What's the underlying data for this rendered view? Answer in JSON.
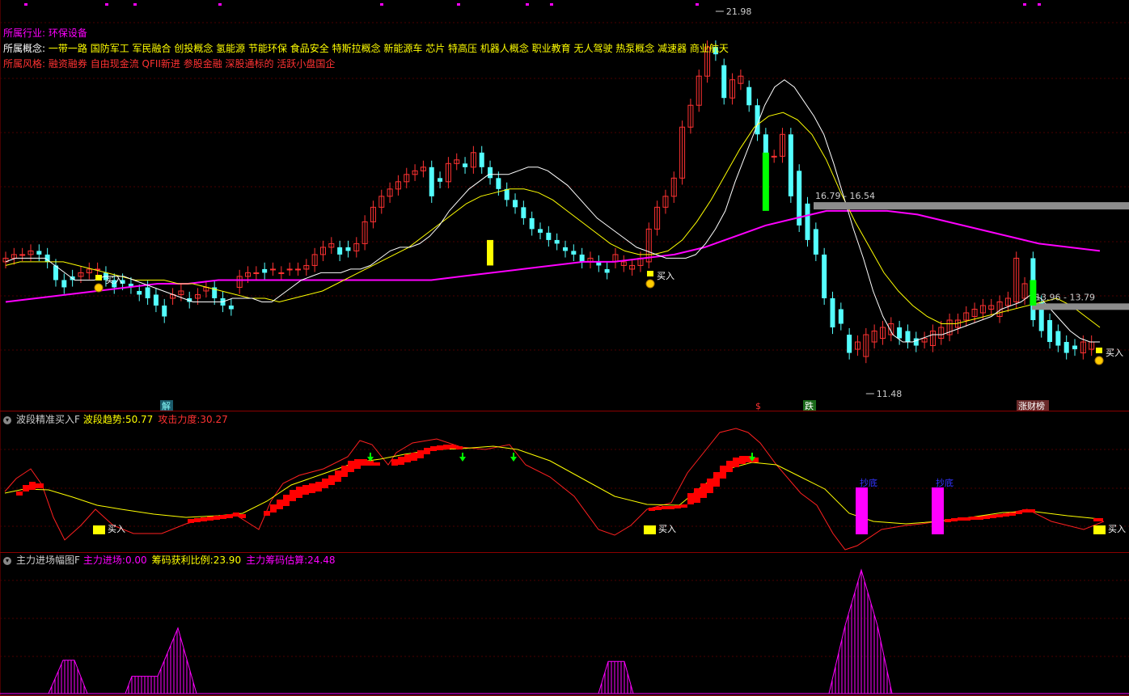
{
  "info": {
    "industry_label": "所属行业:",
    "industry_value": "环保设备",
    "concept_label": "所属概念:",
    "concept_value": "一带一路 国防军工 军民融合 创投概念 氢能源 节能环保 食品安全 特斯拉概念 新能源车 芯片 特高压 机器人概念 职业教育 无人驾驶 热泵概念 减速器 商业航天",
    "style_label": "所属风格:",
    "style_value": "融资融券 自由现金流 QFII新进 参股金融 深股通标的 活跃小盘国企"
  },
  "panel2": {
    "title": "波段精准买入F",
    "trend_label": "波段趋势:",
    "trend_value": "50.77",
    "attack_label": "攻击力度:",
    "attack_value": "30.27"
  },
  "panel3": {
    "title": "主力进场幅图F",
    "enter_label": "主力进场:",
    "enter_value": "0.00",
    "profit_label": "筹码获利比例:",
    "profit_value": "23.90",
    "est_label": "主力筹码估算:",
    "est_value": "24.48"
  },
  "markers": {
    "high_label": "21.98",
    "low_label": "11.48",
    "zone1_label": "16.79 - 16.54",
    "zone2_label": "13.96 - 13.79",
    "buy": "买入",
    "bottom": "抄底",
    "badge_jie": "解",
    "badge_dollar": "$",
    "badge_die": "跌",
    "badge_list": "涨财榜"
  },
  "colors": {
    "up": "#ff3232",
    "down": "#54ffff",
    "ma_white": "#ffffff",
    "ma_yellow": "#ffff00",
    "ma_magenta": "#ff00ff",
    "grid": "#4a0000",
    "panel_border": "#8b0000"
  },
  "chart_data": [
    {
      "type": "candlestick",
      "title": "",
      "ylim": [
        11.48,
        21.98
      ],
      "annotations": [
        "21.98",
        "11.48",
        "16.79 - 16.54",
        "13.96 - 13.79",
        "买入"
      ],
      "series_open": [
        15.1,
        15.2,
        15.3,
        15.3,
        15.4,
        15.3,
        15.0,
        14.6,
        14.7,
        14.7,
        14.8,
        14.9,
        14.8,
        14.6,
        14.6,
        14.5,
        14.3,
        14.4,
        14.2,
        13.9,
        14.1,
        14.2,
        14.1,
        14.1,
        14.3,
        14.4,
        14.1,
        13.9,
        14.4,
        14.7,
        14.8,
        14.9,
        14.9,
        14.8,
        14.9,
        14.9,
        14.9,
        15.0,
        15.3,
        15.5,
        15.5,
        15.5,
        15.4,
        15.6,
        16.2,
        16.6,
        16.9,
        17.1,
        17.3,
        17.5,
        17.6,
        17.7,
        17.4,
        17.3,
        17.8,
        17.8,
        17.7,
        18.1,
        17.7,
        17.4,
        17.1,
        16.8,
        16.6,
        16.3,
        16.0,
        15.9,
        15.7,
        15.5,
        15.4,
        15.3,
        15.1,
        15.1,
        14.9,
        15.1,
        15.0,
        14.9,
        15.0,
        15.1,
        16.0,
        16.6,
        16.9,
        17.4,
        18.8,
        19.4,
        20.2,
        21.0,
        20.5,
        19.6,
        20.0,
        19.9,
        19.4,
        18.6,
        18.0,
        18.0,
        18.6,
        17.6,
        16.7,
        16.0,
        15.3,
        14.1,
        13.8,
        13.1,
        12.7,
        12.5,
        12.9,
        13.0,
        13.1,
        13.3,
        13.2,
        13.0,
        12.9,
        12.8,
        13.0,
        13.1,
        13.3,
        13.5,
        13.6,
        13.7,
        13.8,
        13.6,
        13.9,
        14.0,
        14.1,
        15.2,
        14.0,
        13.5,
        13.2,
        12.9,
        12.8,
        12.6,
        12.7,
        12.9
      ],
      "series_close": [
        15.2,
        15.3,
        15.3,
        15.4,
        15.3,
        15.1,
        14.6,
        14.4,
        14.6,
        14.8,
        14.9,
        14.9,
        14.6,
        14.4,
        14.5,
        14.4,
        14.2,
        14.1,
        13.9,
        13.6,
        14.2,
        14.3,
        14.0,
        14.2,
        14.4,
        14.1,
        13.9,
        13.8,
        14.7,
        14.8,
        14.8,
        14.8,
        14.9,
        14.8,
        14.9,
        14.9,
        15.0,
        15.3,
        15.5,
        15.6,
        15.3,
        15.4,
        15.6,
        16.2,
        16.6,
        16.9,
        17.1,
        17.3,
        17.5,
        17.6,
        17.7,
        16.9,
        17.3,
        17.8,
        17.9,
        17.7,
        18.1,
        17.7,
        17.4,
        17.1,
        16.8,
        16.6,
        16.3,
        16.0,
        15.9,
        15.7,
        15.6,
        15.4,
        15.3,
        15.1,
        15.2,
        15.0,
        14.8,
        15.3,
        15.1,
        15.0,
        15.2,
        16.0,
        16.6,
        16.9,
        17.4,
        18.8,
        19.4,
        20.2,
        21.0,
        20.8,
        19.6,
        20.1,
        20.2,
        19.4,
        18.6,
        18.0,
        18.0,
        18.6,
        16.9,
        16.1,
        15.7,
        15.3,
        14.1,
        13.3,
        13.4,
        12.6,
        12.9,
        13.1,
        13.2,
        13.3,
        13.4,
        13.0,
        12.9,
        12.8,
        13.0,
        13.2,
        13.3,
        13.5,
        13.5,
        13.7,
        13.8,
        13.9,
        13.9,
        14.0,
        14.1,
        15.2,
        14.5,
        13.5,
        13.2,
        12.9,
        12.8,
        12.6,
        12.7,
        12.9,
        12.9
      ],
      "ma_white_y": [
        15.1,
        15.2,
        15.2,
        15.2,
        15.2,
        15.0,
        14.8,
        14.6,
        14.6,
        14.6,
        14.7,
        14.7,
        14.7,
        14.6,
        14.5,
        14.4,
        14.3,
        14.2,
        14.1,
        14.0,
        14.0,
        14.0,
        14.0,
        14.1,
        14.1,
        14.1,
        14.0,
        14.0,
        14.2,
        14.4,
        14.6,
        14.7,
        14.8,
        14.8,
        14.8,
        14.9,
        14.9,
        15.0,
        15.2,
        15.4,
        15.5,
        15.5,
        15.6,
        15.8,
        16.1,
        16.5,
        16.8,
        17.1,
        17.3,
        17.5,
        17.5,
        17.5,
        17.6,
        17.7,
        17.7,
        17.6,
        17.4,
        17.2,
        16.9,
        16.6,
        16.3,
        16.1,
        15.9,
        15.7,
        15.5,
        15.4,
        15.3,
        15.2,
        15.2,
        15.2,
        15.3,
        15.6,
        16.0,
        16.5,
        17.3,
        18.0,
        18.7,
        19.4,
        19.9,
        20.1,
        19.9,
        19.5,
        19.1,
        18.6,
        17.8,
        16.9,
        16.0,
        15.2,
        14.3,
        13.6,
        13.1,
        12.9,
        12.9,
        13.0,
        13.1,
        13.1,
        13.2,
        13.3,
        13.4,
        13.5,
        13.6,
        13.8,
        13.9,
        14.0,
        14.2,
        14.1,
        13.8,
        13.5,
        13.2,
        13.0,
        12.9,
        12.9
      ],
      "ma_yellow_y": [
        15.0,
        15.1,
        15.1,
        15.1,
        15.1,
        15.0,
        14.9,
        14.8,
        14.7,
        14.6,
        14.6,
        14.6,
        14.5,
        14.5,
        14.4,
        14.3,
        14.2,
        14.1,
        14.1,
        14.0,
        14.1,
        14.2,
        14.3,
        14.5,
        14.7,
        14.9,
        15.1,
        15.3,
        15.5,
        15.8,
        16.1,
        16.4,
        16.7,
        16.9,
        17.0,
        17.1,
        17.1,
        17.0,
        16.8,
        16.5,
        16.2,
        15.9,
        15.6,
        15.4,
        15.3,
        15.3,
        15.4,
        15.7,
        16.2,
        16.8,
        17.5,
        18.2,
        18.8,
        19.1,
        19.2,
        19.0,
        18.6,
        17.9,
        17.0,
        16.2,
        15.5,
        14.8,
        14.3,
        13.9,
        13.6,
        13.4,
        13.4,
        13.5,
        13.6,
        13.7,
        13.8,
        13.9,
        14.0,
        14.1,
        13.9,
        13.6,
        13.3
      ],
      "ma_magenta_y": [
        14.0,
        14.1,
        14.2,
        14.3,
        14.4,
        14.5,
        14.5,
        14.6,
        14.6,
        14.6,
        14.6,
        14.6,
        14.6,
        14.6,
        14.6,
        14.7,
        14.8,
        14.9,
        15.0,
        15.1,
        15.1,
        15.2,
        15.3,
        15.5,
        15.8,
        16.1,
        16.3,
        16.5,
        16.5,
        16.5,
        16.4,
        16.2,
        16.0,
        15.8,
        15.6,
        15.5,
        15.4
      ]
    },
    {
      "type": "line",
      "title": "",
      "annotations": [
        "买入",
        "抄底"
      ],
      "series": [
        {
          "name": "波段趋势",
          "values": [
            50.77
          ]
        },
        {
          "name": "攻击力度",
          "values": [
            30.27
          ]
        }
      ]
    },
    {
      "type": "area",
      "title": "",
      "series": [
        {
          "name": "主力进场",
          "values": [
            0,
            0,
            0,
            0,
            0,
            0,
            0,
            0,
            0,
            0,
            0,
            0,
            0,
            0,
            20,
            40,
            40,
            40,
            20,
            0,
            0,
            0,
            0,
            0,
            0,
            0,
            0,
            0,
            20,
            20,
            20,
            20,
            30,
            50,
            80,
            80,
            60,
            40,
            20,
            0,
            0,
            0,
            0,
            0,
            0,
            0,
            0,
            0,
            0,
            0,
            0,
            0,
            0,
            0,
            0,
            0,
            0,
            0,
            0,
            0,
            0,
            0,
            0,
            0,
            0,
            0,
            0,
            0,
            0,
            0,
            0,
            0,
            0,
            0,
            0,
            0,
            0,
            0,
            0,
            0,
            0,
            0,
            0,
            0,
            0,
            0,
            0,
            0,
            0,
            0,
            0,
            0,
            0,
            0,
            0,
            0,
            0,
            0,
            0,
            0,
            0,
            0,
            0,
            0,
            0,
            0,
            0,
            0,
            0,
            0,
            0,
            0,
            0,
            0,
            0,
            0,
            0,
            0,
            0,
            0,
            0,
            0,
            0,
            0,
            0,
            0,
            0,
            0,
            0,
            0,
            0,
            0,
            0,
            0,
            0,
            0,
            0,
            0,
            0,
            0,
            0,
            0,
            0,
            0,
            0,
            0,
            0,
            0,
            0,
            0,
            0,
            0,
            0,
            0,
            0,
            0,
            0,
            0,
            0,
            0,
            0,
            0,
            0,
            0,
            0,
            0,
            0,
            0,
            0,
            0,
            0,
            0,
            0,
            0,
            0,
            0,
            0,
            0,
            0,
            0,
            0,
            0,
            0,
            0,
            0,
            0,
            0,
            0,
            0
          ]
        }
      ]
    }
  ]
}
